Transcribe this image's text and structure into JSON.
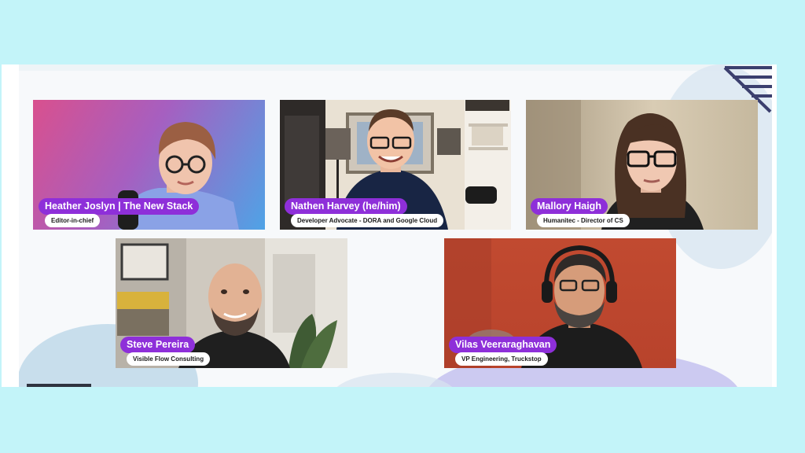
{
  "participants": [
    {
      "name": "Heather Joslyn | The New Stack",
      "title": "Editor-in-chief"
    },
    {
      "name": "Nathen Harvey (he/him)",
      "title": "Developer Advocate - DORA and Google Cloud"
    },
    {
      "name": "Mallory Haigh",
      "title": "Humanitec - Director of CS"
    },
    {
      "name": "Steve Pereira",
      "title": "Visible Flow Consulting"
    },
    {
      "name": "Vilas Veeraraghavan",
      "title": "VP Engineering, Truckstop"
    }
  ],
  "colors": {
    "page_bg": "#c3f4f9",
    "name_pill": "#8e2fd9",
    "title_pill": "#ffffff"
  }
}
